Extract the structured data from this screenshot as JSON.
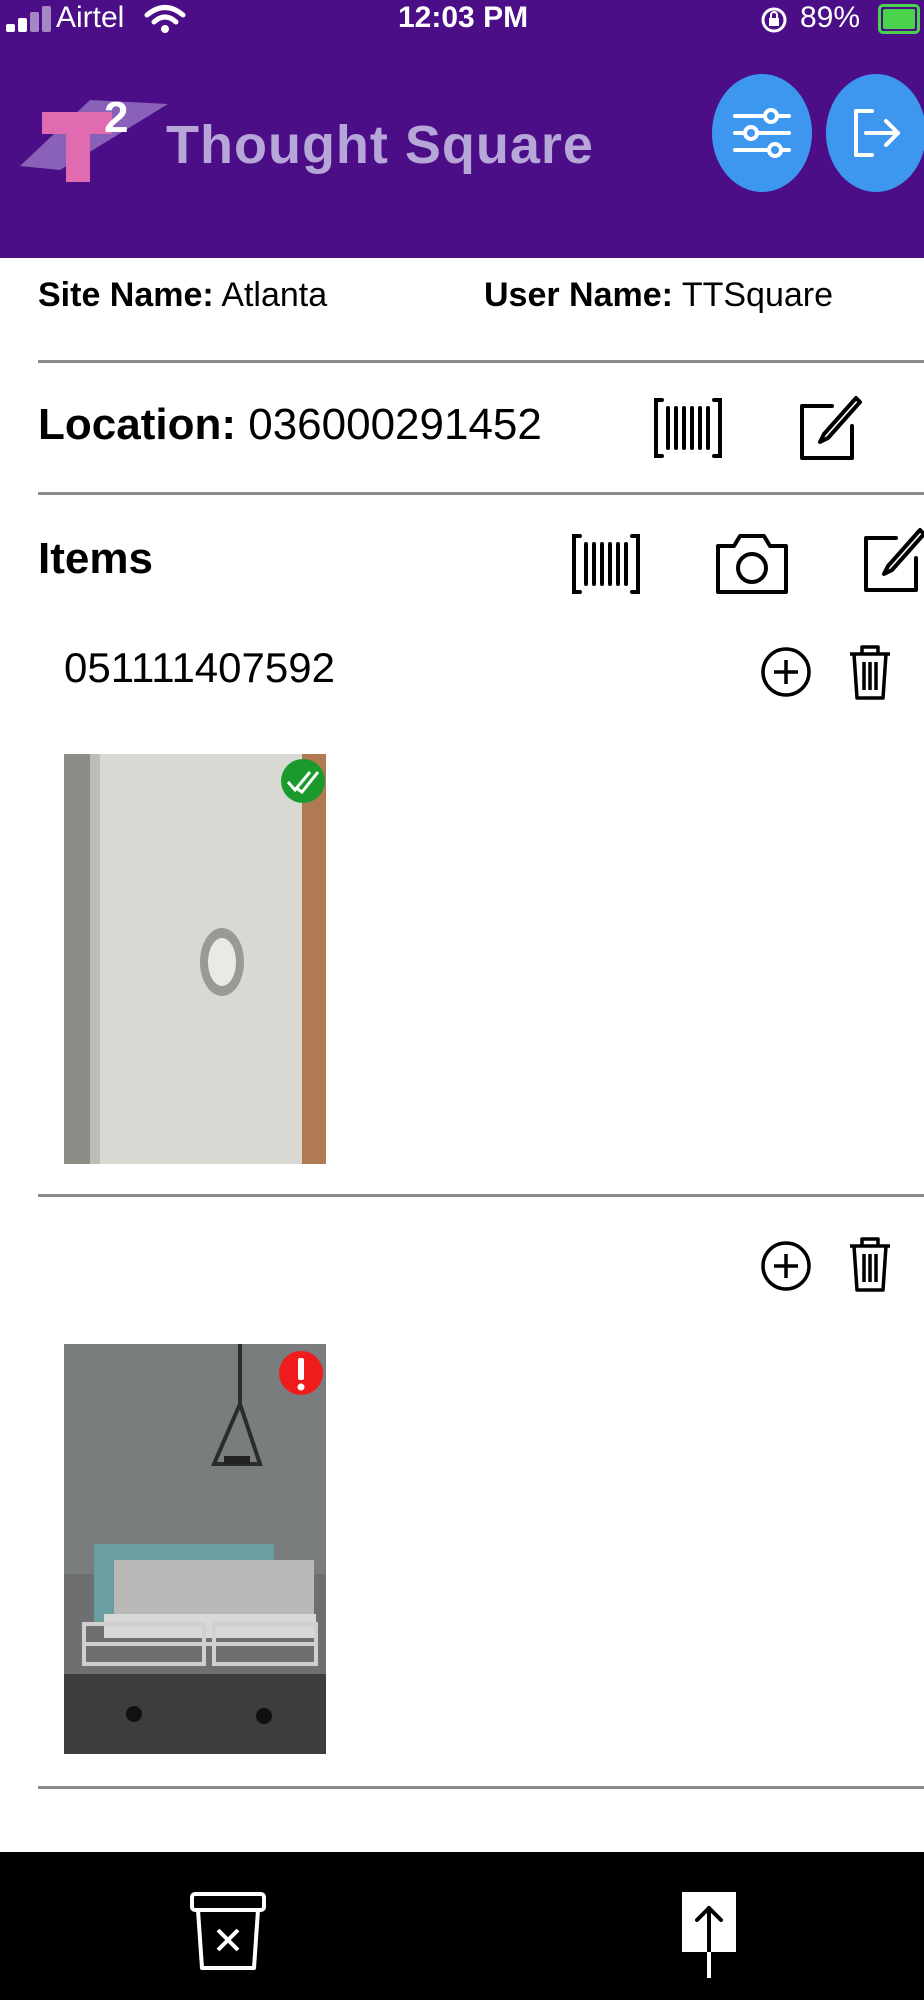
{
  "status_bar": {
    "carrier": "Airtel",
    "time": "12:03 PM",
    "battery": "89%"
  },
  "header": {
    "logo_superscript": "2",
    "logo_text": "Thought Square",
    "filter_icon": "sliders-icon",
    "logout_icon": "logout-icon"
  },
  "info": {
    "site_label": "Site Name:",
    "site_value": "Atlanta",
    "user_label": "User Name:",
    "user_value": "TTSquare"
  },
  "location": {
    "label": "Location:",
    "value": "036000291452",
    "barcode_icon": "barcode-icon",
    "edit_icon": "edit-icon"
  },
  "items": {
    "title": "Items",
    "list": [
      {
        "code": "051111407592",
        "status": "verified",
        "image": "laptop-photo"
      },
      {
        "code": "",
        "status": "error",
        "image": "hospital-bed-photo"
      }
    ]
  },
  "colors": {
    "header_bg": "#4b0e86",
    "accent": "#3d97ef",
    "success": "#1a9a2c",
    "error": "#ee1c1c"
  },
  "bottom_bar": {
    "delete_icon": "trash-x-icon",
    "upload_icon": "upload-icon"
  }
}
